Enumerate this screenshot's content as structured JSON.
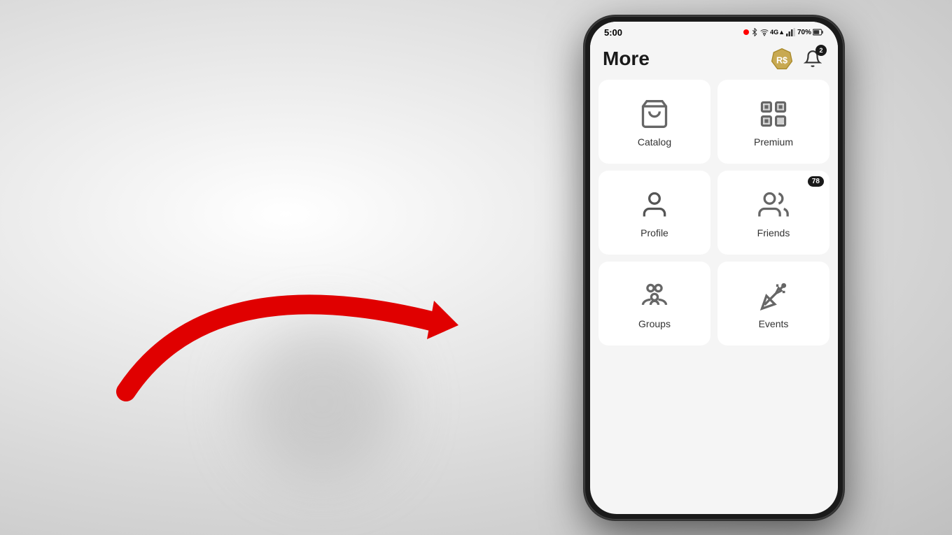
{
  "background": {
    "color": "#e0e0e0"
  },
  "phone": {
    "status_bar": {
      "time": "5:00",
      "battery": "70%",
      "signal_bars": "4",
      "network": "4G"
    },
    "header": {
      "title": "More",
      "robux_icon": "robux-icon",
      "notification_badge": "2"
    },
    "menu_items": [
      {
        "id": "catalog",
        "label": "Catalog",
        "icon": "catalog-icon",
        "badge": null
      },
      {
        "id": "premium",
        "label": "Premium",
        "icon": "premium-icon",
        "badge": null
      },
      {
        "id": "profile",
        "label": "Profile",
        "icon": "profile-icon",
        "badge": null
      },
      {
        "id": "friends",
        "label": "Friends",
        "icon": "friends-icon",
        "badge": "78"
      },
      {
        "id": "groups",
        "label": "Groups",
        "icon": "groups-icon",
        "badge": null
      },
      {
        "id": "events",
        "label": "Events",
        "icon": "events-icon",
        "badge": null
      }
    ]
  },
  "arrow": {
    "color": "#e00000",
    "direction": "right"
  }
}
